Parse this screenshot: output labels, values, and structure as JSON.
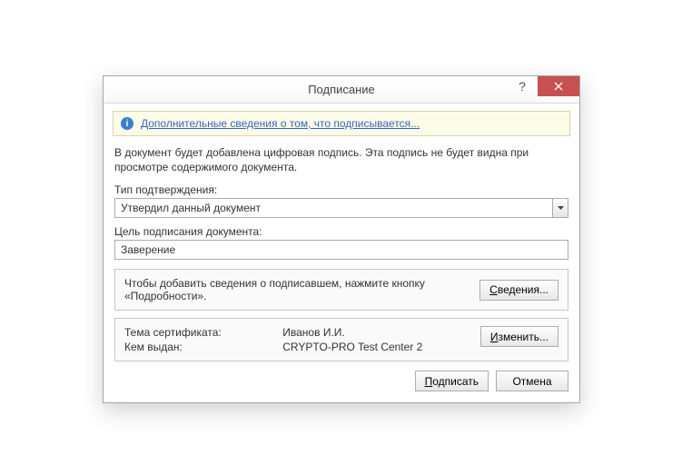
{
  "dialog": {
    "title": "Подписание",
    "help_glyph": "?",
    "info_link": "Дополнительные сведения о том, что подписывается...",
    "description": "В документ будет добавлена цифровая подпись. Эта подпись не будет видна при просмотре содержимого документа.",
    "type_label": "Тип подтверждения:",
    "type_value": "Утвердил данный документ",
    "purpose_label": "Цель подписания документа:",
    "purpose_value": "Заверение",
    "details_hint": "Чтобы добавить сведения о подписавшем, нажмите кнопку «Подробности».",
    "details_btn": "Сведения...",
    "details_btn_ul": "С",
    "details_btn_rest": "ведения...",
    "cert_subject_label": "Тема сертификата:",
    "cert_subject_value": "Иванов И.И.",
    "cert_issuer_label": "Кем выдан:",
    "cert_issuer_value": "CRYPTO-PRO Test Center 2",
    "change_btn_ul": "И",
    "change_btn_rest": "зменить...",
    "sign_btn_ul": "П",
    "sign_btn_rest": "одписать",
    "cancel_btn": "Отмена"
  }
}
